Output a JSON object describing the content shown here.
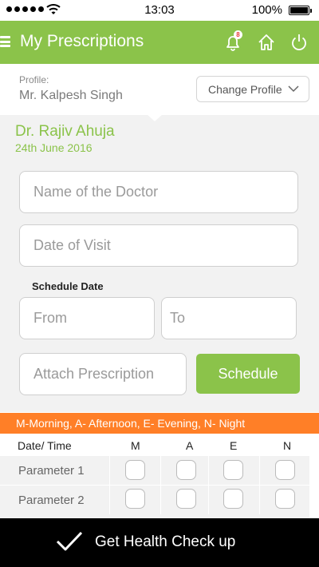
{
  "status_bar": {
    "time": "13:03",
    "battery": "100%",
    "signal_icon": "signal-dots-icon",
    "wifi_icon": "wifi-icon",
    "battery_icon": "battery-icon"
  },
  "header": {
    "title": "My Prescriptions",
    "notification_count": "8",
    "accent": "#8bc34a"
  },
  "profile": {
    "caption": "Profile:",
    "name": "Mr. Kalpesh Singh",
    "change_label": "Change Profile"
  },
  "doctor": {
    "name": "Dr. Rajiv Ahuja",
    "date": "24th June 2016"
  },
  "form": {
    "doctor_placeholder": "Name of the Doctor",
    "visit_placeholder": "Date of Visit",
    "schedule_date_label": "Schedule Date",
    "from_placeholder": "From",
    "to_placeholder": "To",
    "attach_placeholder": "Attach Prescription",
    "schedule_label": "Schedule"
  },
  "legend": {
    "text": "M-Morning, A- Afternoon, E- Evening, N- Night",
    "color": "#ff7f27"
  },
  "table": {
    "headers": {
      "date_time": "Date/ Time",
      "m": "M",
      "a": "A",
      "e": "E",
      "n": "N"
    },
    "rows": [
      {
        "label": "Parameter 1"
      },
      {
        "label": "Parameter 2"
      }
    ]
  },
  "bottom": {
    "label": "Get Health Check up"
  }
}
